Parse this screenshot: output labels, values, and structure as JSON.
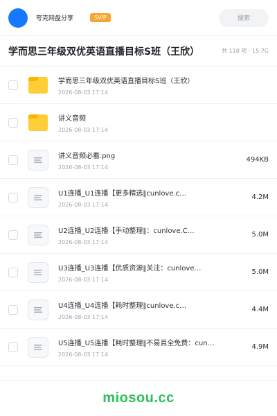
{
  "header": {
    "brand": "夸克网盘分享",
    "svip_badge": "SVIP",
    "search_placeholder": "搜索"
  },
  "share": {
    "title": "学而思三年级双优英语直播目标S班（王欣）",
    "meta": "共 118 项 · 15.7G"
  },
  "list": {
    "items": [
      {
        "type": "folder",
        "name": "学而思三年级双优英语直播目标S班（王欣）",
        "time": "2026-08-03 17:14",
        "size": ""
      },
      {
        "type": "folder",
        "name": "讲义音频",
        "time": "2026-08-03 17:14",
        "size": ""
      },
      {
        "type": "file",
        "name": "讲义音频必看.png",
        "time": "2026-08-03 17:14",
        "size": "494KB"
      },
      {
        "type": "file",
        "name": "U1连播_U1连播【更多精选‖cunlove.c…",
        "time": "2026-08-03 17:14",
        "size": "4.2M"
      },
      {
        "type": "file",
        "name": "U2连播_U2连播【手动整理‖：cunlove.C…",
        "time": "2026-08-03 17:14",
        "size": "5.0M"
      },
      {
        "type": "file",
        "name": "U3连播_U3连播【优质资源‖关注：cunlove…",
        "time": "2026-08-03 17:14",
        "size": "5.0M"
      },
      {
        "type": "file",
        "name": "U4连播_U4连播【耗时整理‖cunlove.c…",
        "time": "2026-08-03 17:14",
        "size": "4.4M"
      },
      {
        "type": "file",
        "name": "U5连播_U5连播【耗时整理‖不易且全免费：cun…",
        "time": "2026-08-03 17:14",
        "size": "4.9M"
      }
    ]
  },
  "footer": {
    "watermark": "miosou.cc"
  },
  "colors": {
    "accent": "#1677ff",
    "svip": "#f7a633",
    "folder": "#ffcd35",
    "watermark": "#2ec05a"
  }
}
